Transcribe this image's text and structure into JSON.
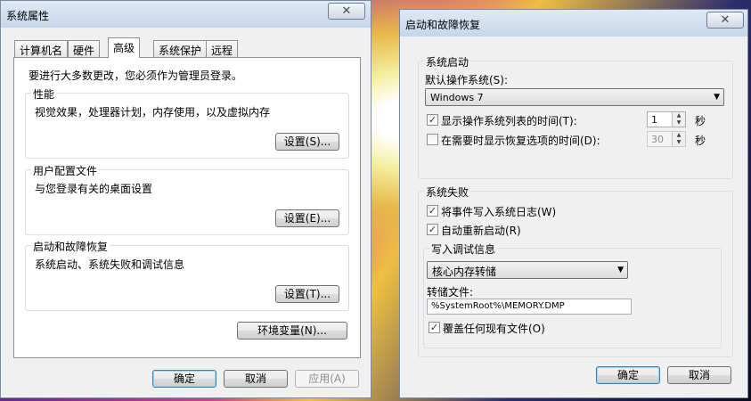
{
  "system_properties": {
    "title": "系统属性",
    "close_glyph": "✕",
    "tabs": [
      {
        "label": "计算机名"
      },
      {
        "label": "硬件"
      },
      {
        "label": "高级"
      },
      {
        "label": "系统保护"
      },
      {
        "label": "远程"
      }
    ],
    "admin_note": "要进行大多数更改，您必须作为管理员登录。",
    "performance": {
      "label": "性能",
      "desc": "视觉效果，处理器计划，内存使用，以及虚拟内存",
      "button": "设置(S)..."
    },
    "user_profiles": {
      "label": "用户配置文件",
      "desc": "与您登录有关的桌面设置",
      "button": "设置(E)..."
    },
    "startup_recovery": {
      "label": "启动和故障恢复",
      "desc": "系统启动、系统失败和调试信息",
      "button": "设置(T)..."
    },
    "env_button": "环境变量(N)...",
    "ok": "确定",
    "cancel": "取消",
    "apply": "应用(A)"
  },
  "startup_dialog": {
    "title": "启动和故障恢复",
    "close_glyph": "✕",
    "system_startup": {
      "label": "系统启动",
      "default_os_label": "默认操作系统(S):",
      "default_os_value": "Windows 7",
      "show_os_list_label": "显示操作系统列表的时间(T):",
      "show_os_list_checked": "✓",
      "show_os_list_value": "1",
      "show_recovery_label": "在需要时显示恢复选项的时间(D):",
      "show_recovery_value": "30",
      "seconds_unit": "秒"
    },
    "system_failure": {
      "label": "系统失败",
      "write_event_label": "将事件写入系统日志(W)",
      "write_event_checked": "✓",
      "auto_restart_label": "自动重新启动(R)",
      "auto_restart_checked": "✓",
      "debug_info": {
        "label": "写入调试信息",
        "type_value": "核心内存转储",
        "dump_file_label": "转储文件:",
        "dump_file_value": "%SystemRoot%\\MEMORY.DMP",
        "overwrite_label": "覆盖任何现有文件(O)",
        "overwrite_checked": "✓"
      }
    },
    "ok": "确定",
    "cancel": "取消"
  }
}
